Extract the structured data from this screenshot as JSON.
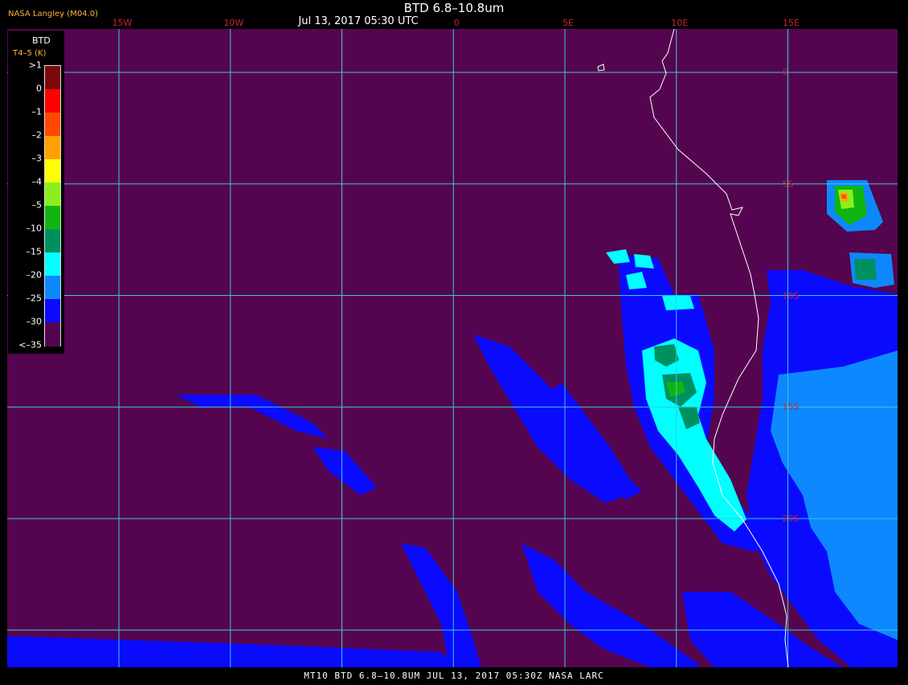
{
  "header": {
    "credit": "NASA Langley (M04.0)",
    "title": "BTD 6.8–10.8um",
    "timestamp": "Jul 13, 2017 05:30 UTC"
  },
  "footer": {
    "caption": "MT10  BTD 6.8–10.8UM  JUL 13, 2017 05:30Z  NASA LARC"
  },
  "legend": {
    "title": "BTD",
    "subtitle": "T4–5 (K)",
    "ticks": [
      ">1",
      "0",
      "–1",
      "–2",
      "–3",
      "–4",
      "–5",
      "–10",
      "–15",
      "–20",
      "–25",
      "–30",
      "<–35"
    ],
    "colors": [
      "#7a0a0a",
      "#ff0000",
      "#ff4800",
      "#ffa000",
      "#ffff00",
      "#8cee1e",
      "#11b511",
      "#009060",
      "#00ffff",
      "#0e88ff",
      "#0a0aff",
      "#55054f"
    ]
  },
  "map": {
    "background_color": "#55054f",
    "grid_color": "#3ac8dd",
    "coast_color": "#ffffff",
    "longitudes": [
      {
        "deg": -15,
        "label": "15W"
      },
      {
        "deg": -10,
        "label": "10W"
      },
      {
        "deg": -5,
        "label": ""
      },
      {
        "deg": 0,
        "label": "0"
      },
      {
        "deg": 5,
        "label": "5E"
      },
      {
        "deg": 10,
        "label": "10E"
      },
      {
        "deg": 15,
        "label": "15E"
      }
    ],
    "latitudes": [
      {
        "deg": 0,
        "label": "0"
      },
      {
        "deg": -5,
        "label": "5S"
      },
      {
        "deg": -10,
        "label": "10S"
      },
      {
        "deg": -15,
        "label": "15S"
      },
      {
        "deg": -20,
        "label": "20S"
      },
      {
        "deg": -25,
        "label": ""
      }
    ]
  }
}
